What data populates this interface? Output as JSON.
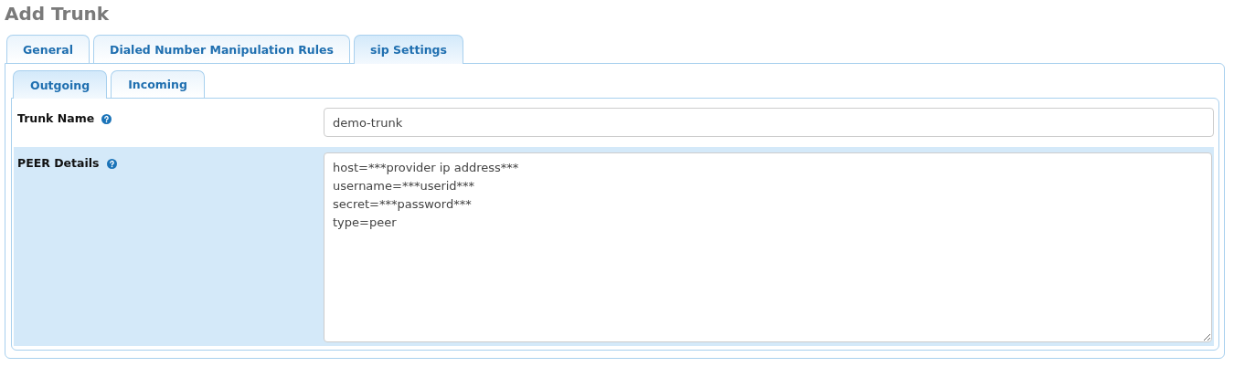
{
  "page": {
    "title": "Add Trunk"
  },
  "tabs": [
    {
      "label": "General",
      "selected": false
    },
    {
      "label": "Dialed Number Manipulation Rules",
      "selected": false
    },
    {
      "label": "sip Settings",
      "selected": true
    }
  ],
  "subtabs": [
    {
      "label": "Outgoing",
      "selected": true
    },
    {
      "label": "Incoming",
      "selected": false
    }
  ],
  "fields": [
    {
      "kind": "input",
      "label": "Trunk Name",
      "value": "demo-trunk",
      "highlighted": false
    },
    {
      "kind": "textarea",
      "label": "PEER Details",
      "value": "host=***provider ip address***\nusername=***userid***\nsecret=***password***\ntype=peer",
      "highlighted": true
    }
  ]
}
